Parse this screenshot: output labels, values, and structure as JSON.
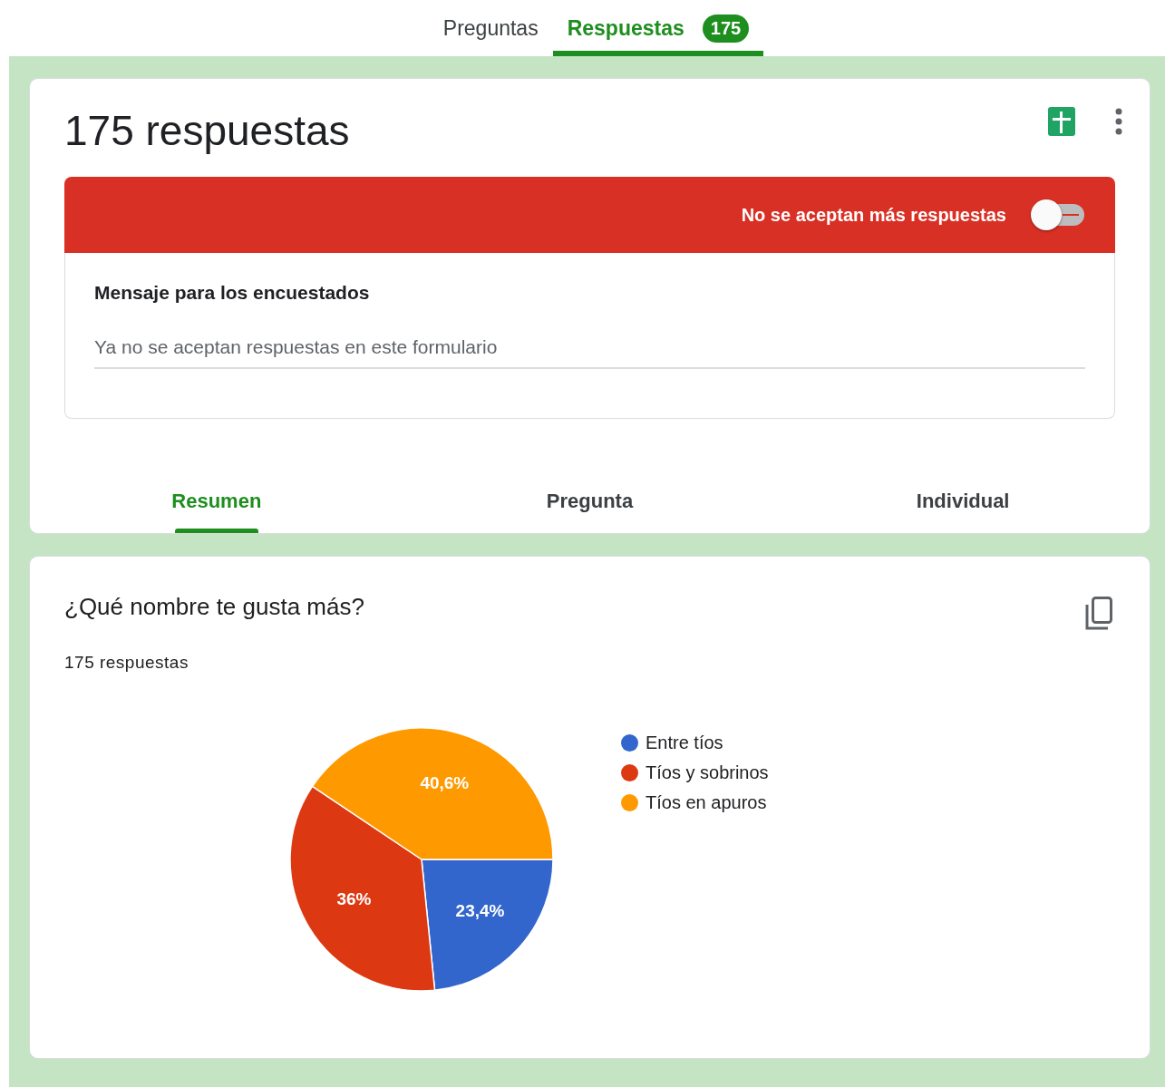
{
  "tabs": [
    {
      "label": "Preguntas",
      "selected": false
    },
    {
      "label": "Respuestas",
      "selected": true,
      "count": "175"
    }
  ],
  "summary_card": {
    "title": "175 respuestas",
    "accepting_banner": {
      "label": "No se aceptan más respuestas",
      "on": false
    },
    "message": {
      "label": "Mensaje para los encuestados",
      "value": "Ya no se aceptan respuestas en este formulario"
    },
    "view_tabs": [
      {
        "label": "Resumen",
        "selected": true
      },
      {
        "label": "Pregunta",
        "selected": false
      },
      {
        "label": "Individual",
        "selected": false
      }
    ]
  },
  "question_card": {
    "title": "¿Qué nombre te gusta más?",
    "subtitle": "175 respuestas",
    "chart_data": {
      "type": "pie",
      "categories": [
        "Entre tíos",
        "Tíos y sobrinos",
        "Tíos en apuros"
      ],
      "values": [
        23.4,
        36,
        40.6
      ],
      "colors": [
        "#3366cc",
        "#dc3912",
        "#ff9900"
      ],
      "value_labels": [
        "23,4%",
        "36%",
        "40,6%"
      ]
    }
  }
}
